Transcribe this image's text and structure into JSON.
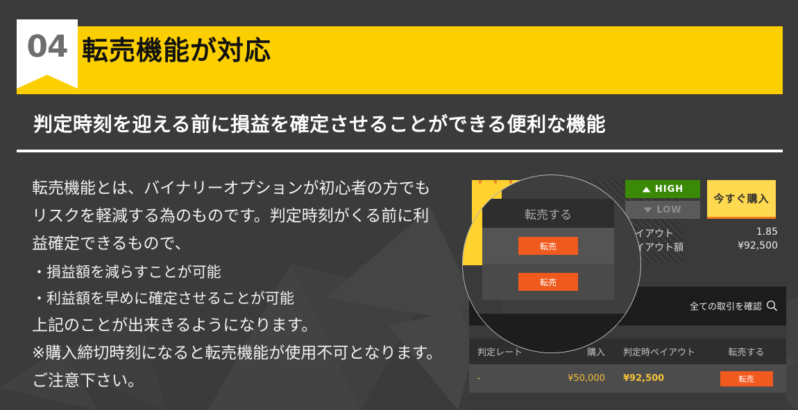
{
  "section": {
    "number": "04",
    "title": "転売機能が対応",
    "subtitle": "判定時刻を迎える前に損益を確定させることができる便利な機能"
  },
  "colors": {
    "accent_yellow": "#fccf00",
    "background": "#3b3b3b",
    "orange": "#f05a1e",
    "green": "#3a8a07",
    "buy_yellow": "#ffd94f"
  },
  "body": {
    "paragraph1": "転売機能とは、バイナリーオプションが初心者の方でも",
    "paragraph2": "リスクを軽減する為のものです。判定時刻がくる前に利",
    "paragraph3": "益確定できるもので、",
    "bullets": [
      "・損益額を減らすことが可能",
      "・利益額を早めに確定させることが可能"
    ],
    "tail": "上記のことが出来きるようになります。",
    "note1": "※購入締切時刻になると転売機能が使用不可となります。",
    "note2": "ご注意下さい。"
  },
  "panel": {
    "high_label": "HIGH",
    "low_label": "LOW",
    "buy_label": "今すぐ購入",
    "payout_label": "ペイアウト",
    "payout_value": "1.85",
    "payout_amount_label": "ペイアウト額",
    "payout_amount_value": "¥92,500",
    "all_trades_label": "全ての取引を確認",
    "search_icon": "search-icon",
    "high_icon": "arch-up-icon",
    "low_icon": "arch-down-icon"
  },
  "magnifier": {
    "header": "転売する",
    "button1": "転売",
    "button2": "転売"
  },
  "table": {
    "headers": [
      "判定レート",
      "購入",
      "判定時ペイアウト",
      "転売する"
    ],
    "rows": [
      {
        "rate": "-",
        "purchase": "¥50,000",
        "payout": "¥92,500",
        "action": "転売"
      }
    ]
  }
}
